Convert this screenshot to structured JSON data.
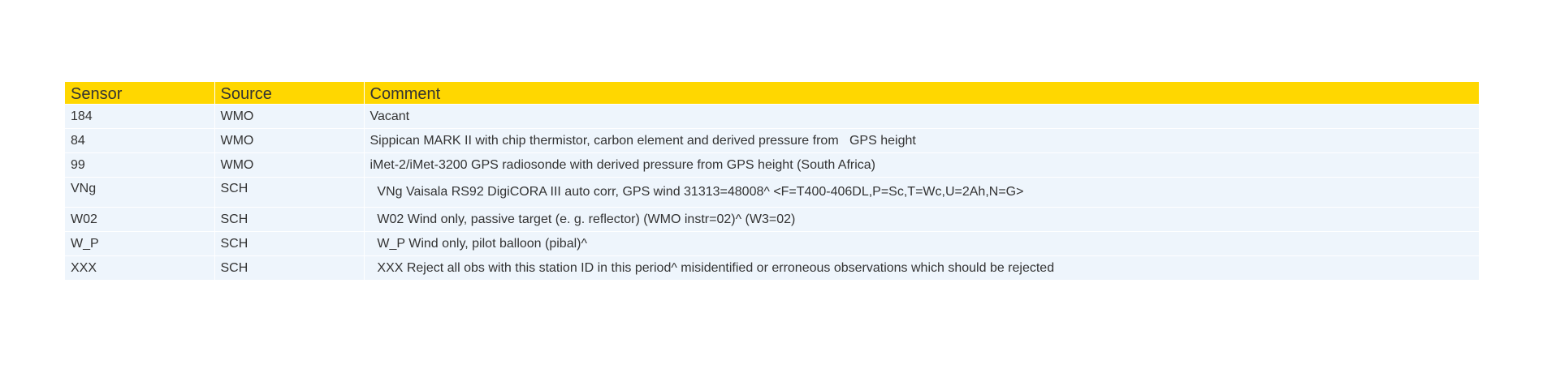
{
  "table": {
    "headers": [
      "Sensor",
      "Source",
      "Comment"
    ],
    "rows": [
      {
        "sensor": "184",
        "source": "WMO",
        "comment": "Vacant"
      },
      {
        "sensor": "84",
        "source": "WMO",
        "comment": "Sippican MARK II with chip thermistor, carbon element and derived pressure from   GPS height"
      },
      {
        "sensor": "99",
        "source": "WMO",
        "comment": "iMet-2/iMet-3200 GPS radiosonde with derived pressure from GPS height (South Africa)"
      },
      {
        "sensor": "VNg",
        "source": "SCH",
        "comment": "  VNg Vaisala RS92 DigiCORA III auto corr, GPS wind 31313=48008^ <F=T400-406DL,P=Sc,T=Wc,U=2Ah,N=G>"
      },
      {
        "sensor": "W02",
        "source": "SCH",
        "comment": "  W02 Wind only, passive target (e. g. reflector) (WMO instr=02)^ (W3=02)"
      },
      {
        "sensor": "W_P",
        "source": "SCH",
        "comment": "  W_P Wind only, pilot balloon (pibal)^"
      },
      {
        "sensor": "XXX",
        "source": "SCH",
        "comment": "  XXX Reject all obs with this station ID in this period^ misidentified or erroneous observations which should be rejected"
      }
    ]
  },
  "colors": {
    "header_bg": "#ffd700",
    "row_bg": "#eef5fc",
    "text": "#333333"
  }
}
